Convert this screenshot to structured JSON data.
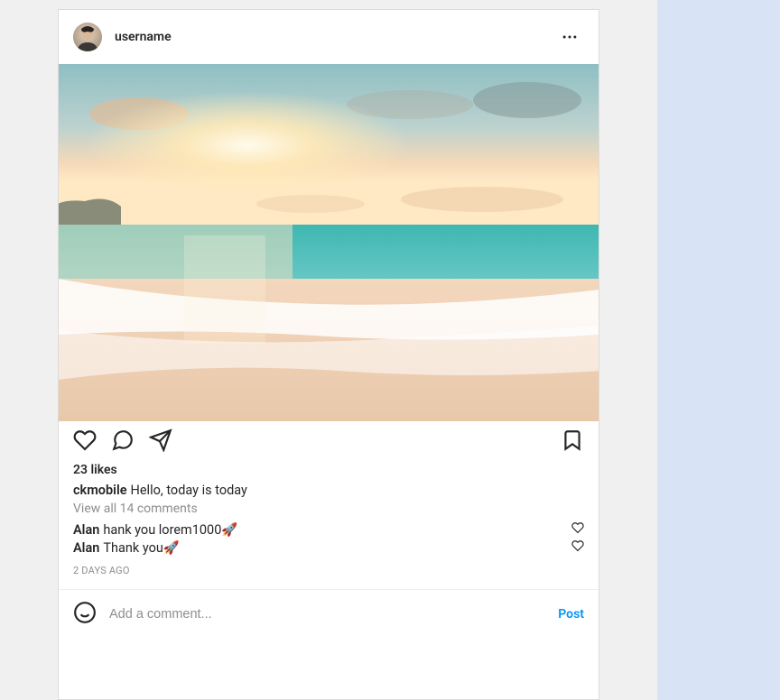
{
  "header": {
    "username": "username"
  },
  "post": {
    "likes_text": "23 likes",
    "caption_author": "ckmobile",
    "caption_text": "Hello, today is today",
    "view_all_text": "View all 14 comments",
    "timestamp": "2 DAYS AGO"
  },
  "comments": [
    {
      "author": "Alan",
      "text": "hank you lorem1000🚀"
    },
    {
      "author": "Alan",
      "text": "Thank you🚀"
    }
  ],
  "composer": {
    "placeholder": "Add a comment...",
    "post_label": "Post"
  }
}
